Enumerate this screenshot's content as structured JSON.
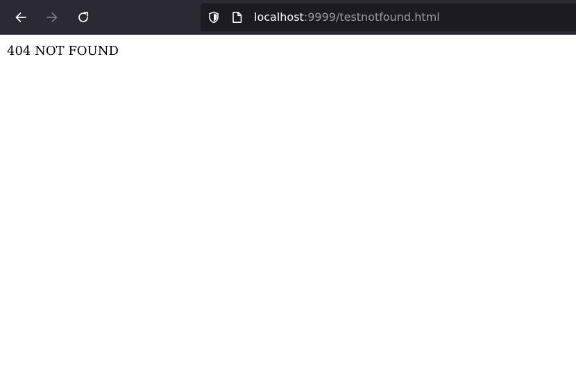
{
  "toolbar": {
    "back_icon": "arrow-left-icon",
    "forward_icon": "arrow-right-icon",
    "reload_icon": "reload-icon",
    "background_color": "#2b2a33"
  },
  "urlbar": {
    "shield_icon": "tracking-protection-shield-icon",
    "page_icon": "page-document-icon",
    "host": "localhost",
    "rest": ":9999/testnotfound.html",
    "host_color": "#fbfbfe",
    "rest_color": "#9c9ba5"
  },
  "page": {
    "message": "404 NOT FOUND"
  }
}
